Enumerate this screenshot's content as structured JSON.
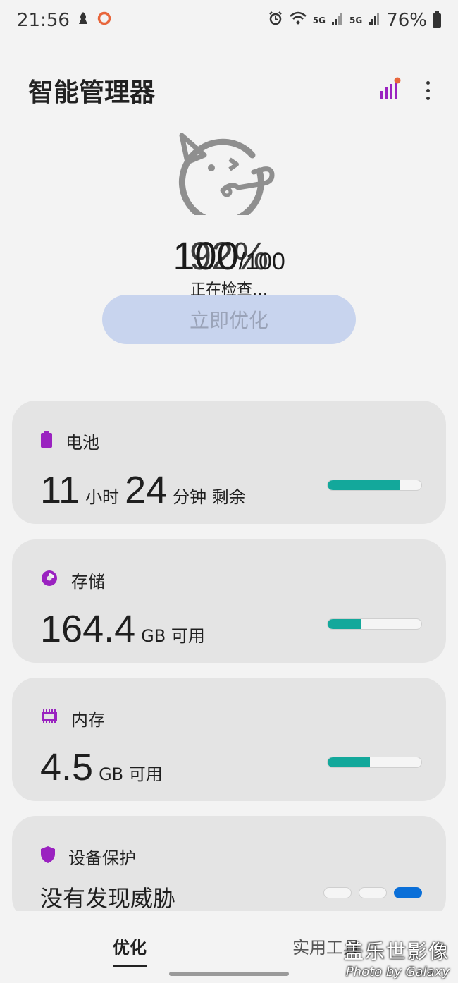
{
  "status_bar": {
    "time": "21:56",
    "battery": "76%",
    "net1": "5G",
    "net2": "5G"
  },
  "header": {
    "title": "智能管理器"
  },
  "hero": {
    "score": "100",
    "score_denom": "/100",
    "score_overlay": "92%",
    "checking_text": "正在检查…",
    "optimize_label": "立即优化"
  },
  "cards": {
    "battery": {
      "label": "电池",
      "hours": "11",
      "hours_unit": "小时",
      "minutes": "24",
      "minutes_unit": "分钟 剩余",
      "progress": 0.77,
      "icon": "battery-icon"
    },
    "storage": {
      "label": "存储",
      "value": "164.4",
      "unit": "GB 可用",
      "progress": 0.36,
      "icon": "pie-chart-icon"
    },
    "memory": {
      "label": "内存",
      "value": "4.5",
      "unit": "GB 可用",
      "progress": 0.45,
      "icon": "memory-chip-icon"
    },
    "protection": {
      "label": "设备保护",
      "status": "没有发现威胁",
      "icon": "shield-icon"
    }
  },
  "nav": {
    "tab_optimize": "优化",
    "tab_tools": "实用工具"
  },
  "watermark": {
    "cn": "盖乐世影像",
    "en": "Photo by Galaxy"
  },
  "colors": {
    "accent_purple": "#9a22c0",
    "progress_teal": "#13a89b",
    "active_blue": "#0a6fd8",
    "button_bg": "#c8d4ee"
  }
}
